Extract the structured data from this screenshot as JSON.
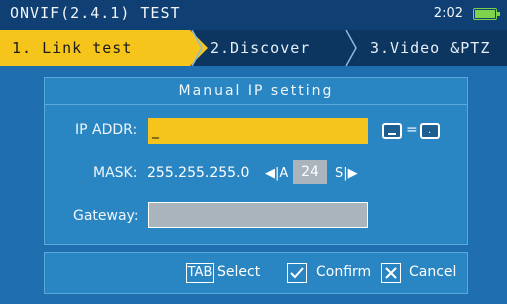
{
  "status_bar": {
    "title": "ONVIF(2.4.1) TEST",
    "time": "2:02",
    "battery_level": 1.0
  },
  "tabs": [
    {
      "label": "1. Link test",
      "active": true
    },
    {
      "label": "2.Discover",
      "active": false
    },
    {
      "label": "3.Video &PTZ",
      "active": false
    }
  ],
  "dialog": {
    "title": "Manual IP setting",
    "ip_label": "IP ADDR:",
    "ip_value": "_",
    "key_hint_equals": "=",
    "key_hint_dot": ".",
    "mask_label": "MASK:",
    "mask_value": "255.255.255.0",
    "mask_left_ctrl": "◀|A",
    "mask_prefix": "24",
    "mask_right_ctrl": "S|▶",
    "gateway_label": "Gateway:",
    "gateway_value": ""
  },
  "footer": {
    "tab_key": "TAB",
    "select_label": "Select",
    "confirm_label": "Confirm",
    "cancel_label": "Cancel"
  },
  "colors": {
    "accent": "#f5c51c",
    "background": "#1f6fb0",
    "panel": "#2a86c3"
  }
}
